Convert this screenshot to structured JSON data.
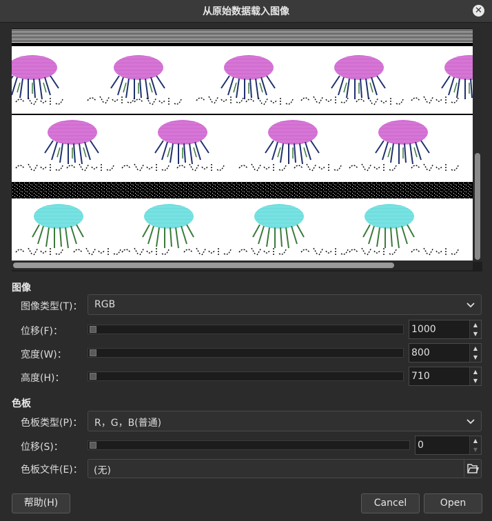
{
  "window": {
    "title": "从原始数据载入图像",
    "close_icon": "close-icon"
  },
  "image_section": {
    "heading": "图像",
    "image_type": {
      "label": "图像类型(T)：",
      "value": "RGB"
    },
    "offset": {
      "label": "位移(F)：",
      "value": "1000"
    },
    "width": {
      "label": "宽度(W)：",
      "value": "800"
    },
    "height": {
      "label": "高度(H)：",
      "value": "710"
    }
  },
  "palette_section": {
    "heading": "色板",
    "palette_type": {
      "label": "色板类型(P)：",
      "value": "R，G，B(普通)"
    },
    "offset": {
      "label": "位移(S)：",
      "value": "0"
    },
    "palette_file": {
      "label": "色板文件(E)：",
      "value": "(无)"
    }
  },
  "buttons": {
    "help": "帮助(H)",
    "cancel": "Cancel",
    "open": "Open"
  },
  "colors": {
    "background": "#2b2b2b",
    "preview_magenta": "#c855c8",
    "preview_cyan": "#4fd6d6",
    "tentacle_green": "#3a7a3a",
    "tentacle_blue": "#2a3a8a"
  }
}
